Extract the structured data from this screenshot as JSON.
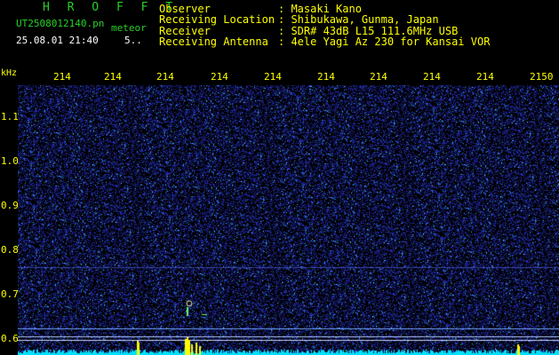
{
  "header": {
    "app_name": "H R O F F T",
    "filename": "UT2508012140.pn",
    "detector": "meteor",
    "datetime": "25.08.01 21:40",
    "count": "5.."
  },
  "info": [
    {
      "label": "Observer",
      "value": ": Masaki Kano"
    },
    {
      "label": "Receiving Location",
      "value": ": Shibukawa, Gunma, Japan"
    },
    {
      "label": "Receiver",
      "value": ": SDR# 43dB L15 111.6MHz USB"
    },
    {
      "label": "Receiving Antenna",
      "value": ": 4ele Yagi Az 230 for Kansai VOR"
    }
  ],
  "axis": {
    "y_unit": "kHz",
    "x_ticks": [
      "214",
      "214",
      "214",
      "214",
      "214",
      "214",
      "214",
      "214",
      "214",
      "2150"
    ],
    "y_ticks": [
      "1.1",
      "1.0",
      "0.9",
      "0.8",
      "0.7",
      "0.6"
    ]
  },
  "colors": {
    "background": "#000000",
    "noise": "#1c1c9a",
    "signal": "#00e0ff",
    "burst": "#ffff00",
    "text": "#28d028"
  }
}
